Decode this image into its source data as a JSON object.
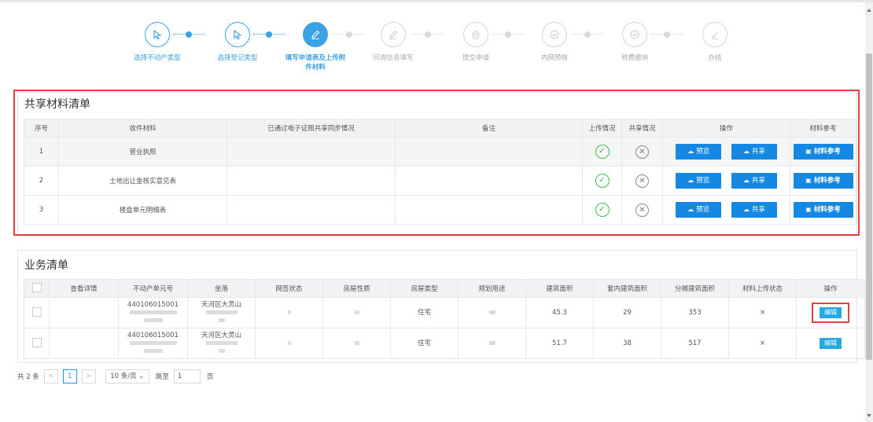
{
  "steps": [
    {
      "label": "选择不动产类型",
      "state": "done"
    },
    {
      "label": "选择登记类型",
      "state": "done"
    },
    {
      "label": "填写申请表及上传附件材料",
      "state": "active"
    },
    {
      "label": "问询信息填写",
      "state": "todo"
    },
    {
      "label": "提交申请",
      "state": "todo"
    },
    {
      "label": "内网预核",
      "state": "todo"
    },
    {
      "label": "税费缴纳",
      "state": "todo"
    },
    {
      "label": "办结",
      "state": "todo"
    }
  ],
  "shared": {
    "title": "共享材料清单",
    "headers": {
      "index": "序号",
      "material": "收件材料",
      "sync": "已通过电子证照共享同步情况",
      "note": "备注",
      "upload": "上传情况",
      "share_status": "共享情况",
      "ops": "操作",
      "ref": "材料参考"
    },
    "rows": [
      {
        "index": "1",
        "material": "营业执照"
      },
      {
        "index": "2",
        "material": "土地出让金核实意见表"
      },
      {
        "index": "3",
        "material": "楼盘单元明细表"
      }
    ],
    "preview_label": "预览",
    "share_label": "共享",
    "ref_label": "材料参考"
  },
  "business": {
    "title": "业务清单",
    "headers": {
      "detail": "查看详情",
      "unit_no": "不动产单元号",
      "location": "坐落",
      "sign": "网签状态",
      "nature": "房屋性质",
      "type": "房屋类型",
      "usage": "规划用途",
      "area": "建筑面积",
      "inner_area": "套内建筑面积",
      "shared_area": "分摊建筑面积",
      "upload_status": "材料上传状态",
      "op": "操作"
    },
    "rows": [
      {
        "unit_no": "440106015001",
        "location": "天河区大灵山",
        "type": "住宅",
        "area": "45.3",
        "inner_area": "29",
        "shared_area": "353",
        "upload_status": "×",
        "edit": "编辑"
      },
      {
        "unit_no": "440106015001",
        "location": "天河区大灵山",
        "type": "住宅",
        "area": "51.7",
        "inner_area": "38",
        "shared_area": "517",
        "upload_status": "×",
        "edit": "编辑"
      }
    ]
  },
  "pager": {
    "total": "共 2 条",
    "prev": "<",
    "page": "1",
    "next": ">",
    "page_size": "10 条/页",
    "goto_label": "跳至",
    "goto_value": "1",
    "page_unit": "页"
  },
  "colors": {
    "accent": "#3aa3e3",
    "button": "#1488e2",
    "highlight": "#e54040",
    "ok": "#3bbd4a"
  }
}
